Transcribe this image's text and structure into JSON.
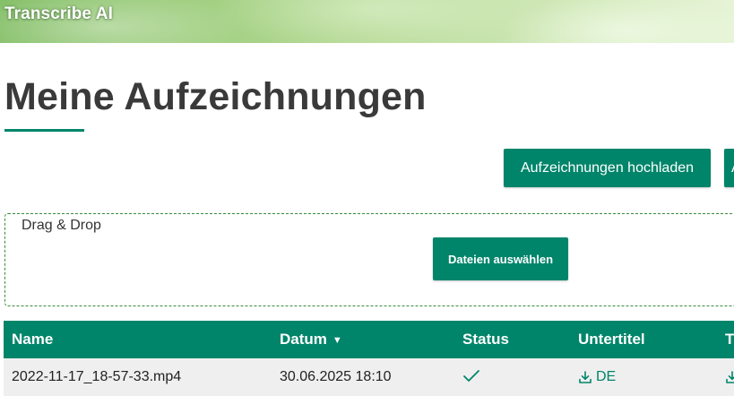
{
  "header": {
    "brand": "Transcribe AI"
  },
  "page": {
    "title": "Meine Aufzeichnungen"
  },
  "toolbar": {
    "upload_label": "Aufzeichnungen hochladen",
    "next_label": "A"
  },
  "dropzone": {
    "label": "Drag & Drop",
    "select_label": "Dateien auswählen"
  },
  "table": {
    "columns": [
      "Name",
      "Datum",
      "Status",
      "Untertitel",
      "T"
    ],
    "sort_icon": "sort-down-icon",
    "rows": [
      {
        "name": "2022-11-17_18-57-33.mp4",
        "date": "30.06.2025 18:10",
        "status_icon": "check-icon",
        "subtitle_lang": "DE",
        "subtitle_icon": "download-icon"
      }
    ]
  },
  "colors": {
    "accent": "#00856a",
    "row_bg": "#efefef",
    "title": "#3a3a3a"
  }
}
